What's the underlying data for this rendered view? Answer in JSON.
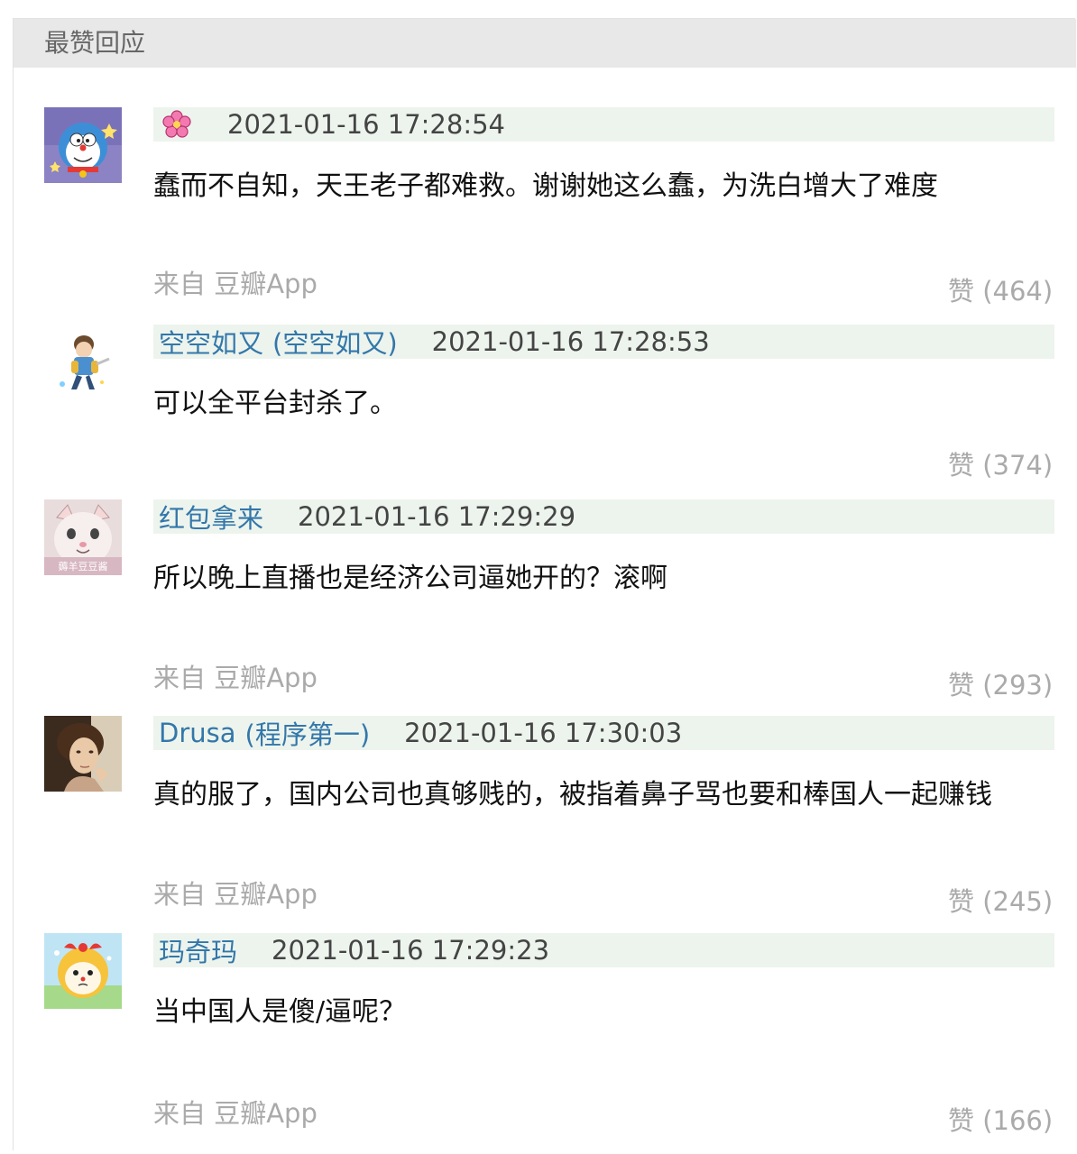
{
  "section": {
    "title": "最赞回应"
  },
  "comments": [
    {
      "author": "",
      "nickname": "",
      "time": "2021-01-16 17:28:54",
      "content": "蠢而不自知，天王老子都难救。谢谢她这么蠢，为洗白增大了难度",
      "source": "来自 豆瓣App",
      "like": "赞 (464)",
      "author_icon": "flower-icon"
    },
    {
      "author": "空空如又",
      "nickname": "(空空如又)",
      "time": "2021-01-16 17:28:53",
      "content": "可以全平台封杀了。",
      "source": "",
      "like": "赞 (374)"
    },
    {
      "author": "红包拿来",
      "nickname": "",
      "time": "2021-01-16 17:29:29",
      "content": "所以晚上直播也是经济公司逼她开的？滚啊",
      "source": "来自 豆瓣App",
      "like": "赞 (293)",
      "avatar_caption": "薅羊豆豆酱"
    },
    {
      "author": "Drusa",
      "nickname": "(程序第一)",
      "time": "2021-01-16 17:30:03",
      "content": "真的服了，国内公司也真够贱的，被指着鼻子骂也要和棒国人一起赚钱",
      "source": "来自 豆瓣App",
      "like": "赞 (245)"
    },
    {
      "author": "玛奇玛",
      "nickname": "",
      "time": "2021-01-16 17:29:23",
      "content": "当中国人是傻/逼呢？",
      "source": "来自 豆瓣App",
      "like": "赞 (166)"
    }
  ],
  "colors": {
    "link": "#3377aa",
    "meta_bg": "#edf4ed",
    "header_bg": "#e8e8e8",
    "muted": "#aaaaaa"
  }
}
